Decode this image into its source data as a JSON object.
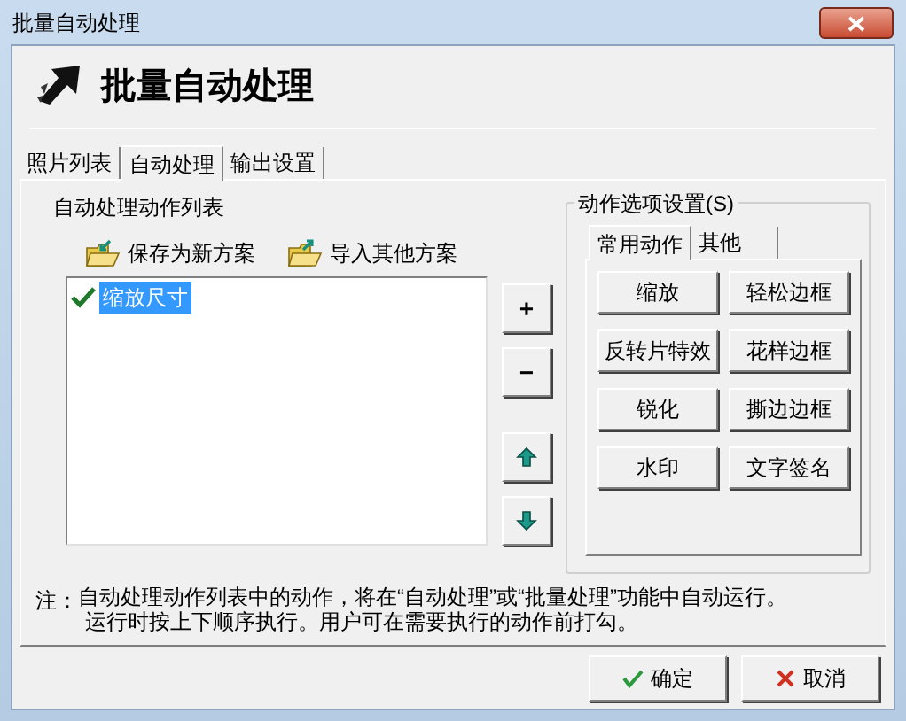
{
  "window": {
    "title": "批量自动处理"
  },
  "header": {
    "title": "批量自动处理"
  },
  "tabs": [
    {
      "label": "照片列表",
      "selected": false
    },
    {
      "label": "自动处理",
      "selected": true
    },
    {
      "label": "输出设置",
      "selected": false
    }
  ],
  "action_list": {
    "title": "自动处理动作列表",
    "toolbar": [
      "保存为新方案",
      "导入其他方案"
    ],
    "items": [
      {
        "label": "缩放尺寸",
        "checked": true,
        "selected": true
      }
    ],
    "side_buttons": [
      {
        "kind": "add",
        "label": "+"
      },
      {
        "kind": "remove",
        "label": "−"
      },
      {
        "kind": "up"
      },
      {
        "kind": "down"
      }
    ]
  },
  "options": {
    "title": "动作选项设置(S)",
    "tabs": [
      {
        "label": "常用动作",
        "selected": true
      },
      {
        "label": "其他",
        "selected": false
      }
    ],
    "buttons": [
      "缩放",
      "轻松边框",
      "反转片特效",
      "花样边框",
      "锐化",
      "撕边边框",
      "水印",
      "文字签名"
    ]
  },
  "note": [
    "注：",
    "自动处理动作列表中的动作，将在“自动处理”或“批量处理”功能中自动运行。",
    "运行时按上下顺序执行。用户可在需要执行的动作前打勾。"
  ],
  "footer_buttons": [
    {
      "kind": "ok",
      "label": "确定"
    },
    {
      "kind": "cancel",
      "label": "取消"
    }
  ]
}
